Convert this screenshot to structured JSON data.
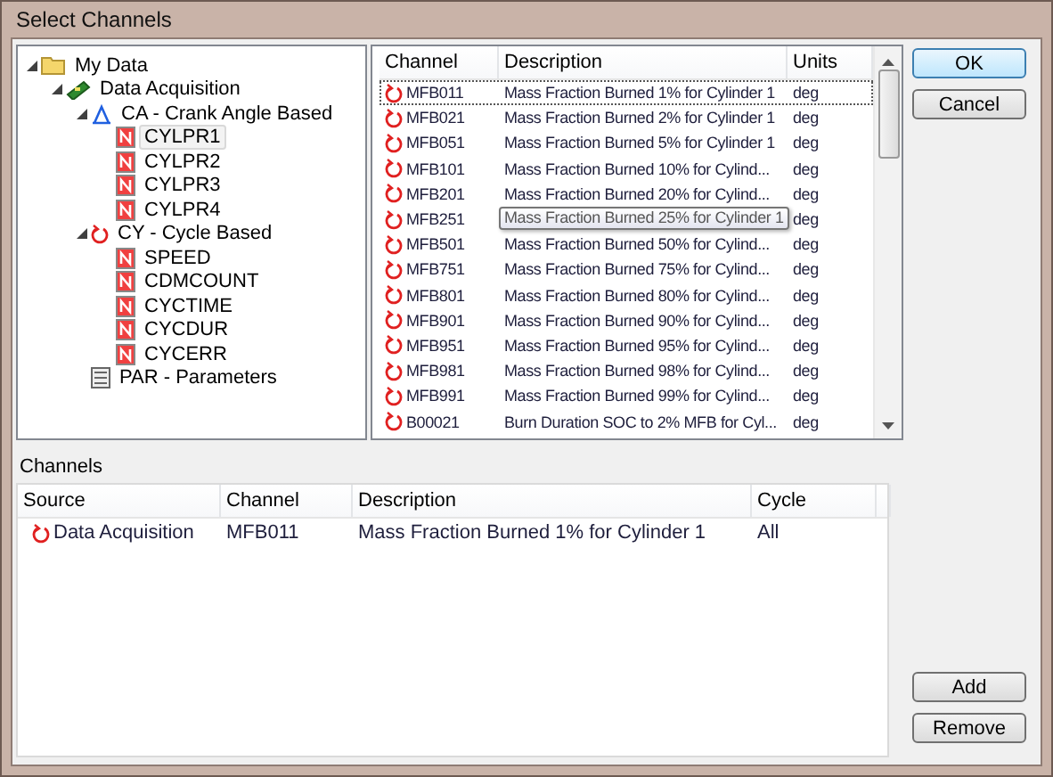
{
  "window": {
    "title": "Select Channels"
  },
  "tree": [
    {
      "label": "My Data",
      "kind": "folder",
      "expanded": true,
      "selected": false,
      "children": [
        {
          "label": "Data Acquisition",
          "kind": "acquisition",
          "expanded": true,
          "selected": false,
          "children": [
            {
              "label": "CA - Crank Angle Based",
              "kind": "crank",
              "expanded": true,
              "selected": false,
              "children": [
                {
                  "label": "CYLPR1",
                  "kind": "channel",
                  "selected": true
                },
                {
                  "label": "CYLPR2",
                  "kind": "channel",
                  "selected": false
                },
                {
                  "label": "CYLPR3",
                  "kind": "channel",
                  "selected": false
                },
                {
                  "label": "CYLPR4",
                  "kind": "channel",
                  "selected": false
                }
              ]
            },
            {
              "label": "CY - Cycle Based",
              "kind": "cycle",
              "expanded": true,
              "selected": false,
              "children": [
                {
                  "label": "SPEED",
                  "kind": "channel",
                  "selected": false
                },
                {
                  "label": "CDMCOUNT",
                  "kind": "channel",
                  "selected": false
                },
                {
                  "label": "CYCTIME",
                  "kind": "channel",
                  "selected": false
                },
                {
                  "label": "CYCDUR",
                  "kind": "channel",
                  "selected": false
                },
                {
                  "label": "CYCERR",
                  "kind": "channel",
                  "selected": false
                }
              ]
            },
            {
              "label": "PAR - Parameters",
              "kind": "parameters",
              "selected": false
            }
          ]
        }
      ]
    }
  ],
  "list": {
    "columns": [
      "Channel",
      "Description",
      "Units"
    ],
    "rows": [
      {
        "channel": "MFB011",
        "description": "Mass Fraction Burned 1% for Cylinder 1",
        "units": "deg",
        "selected": true
      },
      {
        "channel": "MFB021",
        "description": "Mass Fraction Burned 2% for Cylinder 1",
        "units": "deg",
        "selected": false
      },
      {
        "channel": "MFB051",
        "description": "Mass Fraction Burned 5% for Cylinder 1",
        "units": "deg",
        "selected": false
      },
      {
        "channel": "MFB101",
        "description": "Mass Fraction Burned 10% for Cylind...",
        "units": "deg",
        "selected": false
      },
      {
        "channel": "MFB201",
        "description": "Mass Fraction Burned 20% for Cylind...",
        "units": "deg",
        "selected": false
      },
      {
        "channel": "MFB251",
        "tooltip": "Mass Fraction Burned 25% for Cylinder 1",
        "units": "deg",
        "selected": false
      },
      {
        "channel": "MFB501",
        "description": "Mass Fraction Burned 50% for Cylind...",
        "units": "deg",
        "selected": false
      },
      {
        "channel": "MFB751",
        "description": "Mass Fraction Burned 75% for Cylind...",
        "units": "deg",
        "selected": false
      },
      {
        "channel": "MFB801",
        "description": "Mass Fraction Burned 80% for Cylind...",
        "units": "deg",
        "selected": false
      },
      {
        "channel": "MFB901",
        "description": "Mass Fraction Burned 90% for Cylind...",
        "units": "deg",
        "selected": false
      },
      {
        "channel": "MFB951",
        "description": "Mass Fraction Burned 95% for Cylind...",
        "units": "deg",
        "selected": false
      },
      {
        "channel": "MFB981",
        "description": "Mass Fraction Burned 98% for Cylind...",
        "units": "deg",
        "selected": false
      },
      {
        "channel": "MFB991",
        "description": "Mass Fraction Burned 99% for Cylind...",
        "units": "deg",
        "selected": false
      },
      {
        "channel": "B00021",
        "description": "Burn Duration SOC to 2% MFB for Cyl...",
        "units": "deg",
        "selected": false
      }
    ]
  },
  "side_buttons": [
    {
      "label": "OK",
      "default": true
    },
    {
      "label": "Cancel",
      "default": false
    }
  ],
  "channels": {
    "title": "Channels",
    "columns": [
      "Source",
      "Channel",
      "Description",
      "Cycle"
    ],
    "rows": [
      {
        "source": "Data Acquisition",
        "channel": "MFB011",
        "description": "Mass Fraction Burned 1% for Cylinder 1",
        "cycle": "All"
      }
    ]
  },
  "bottom_buttons": [
    "Add",
    "Remove"
  ]
}
